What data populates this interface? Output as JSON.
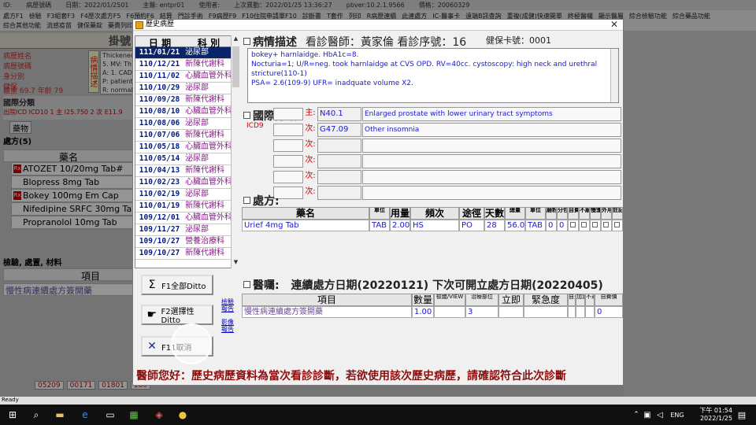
{
  "topbar": {
    "items": [
      "ID:",
      "病歷號碼",
      "日期：2022/01/2501",
      "主醫: entpr01",
      "使用者:",
      "上次異動：2022/01/25 13:36:27",
      "pbver:10.2.1.9566",
      "價格：20060329"
    ]
  },
  "menubar": {
    "row1": [
      "處方F1",
      "檢驗",
      "F3組套F3",
      "F4歷次處方F5",
      "F6預約F6",
      "結算",
      "門診手術",
      "F9病歷F9",
      "F10住院申請單F10",
      "診斷書",
      "T套作",
      "列印",
      "R病歷連續",
      "此連處方",
      "IC-醫事卡",
      "遠端B訊查詢",
      "重複(成健)快速開單",
      "終極醫囑",
      "顯示醫屬",
      "綜合檢驗功能",
      "綜合藥品功能"
    ],
    "row2": [
      "綜合其他功能",
      "流感疫苗",
      "健保藥錠",
      "藥費列印"
    ]
  },
  "background": {
    "title": "掛號",
    "info_labels": [
      "病歷姓名",
      "病歷號碼",
      "身分別",
      "健保"
    ],
    "side_label": "病情描述",
    "desc_lines": [
      "Thickened",
      "5. MV: Th",
      "A: 1. CAD",
      "P: patient",
      "R: normal"
    ],
    "vitals": "體重 69.7   年齡 79",
    "icd_label": "國際分類",
    "icd_row": "出院ICD  ICD10  1 主  I25.750  2 次  E11.9",
    "med_button": "藥物",
    "rx_label": "處方(5)",
    "drug_header": "藥名",
    "drugs": [
      {
        "name": "ATOZET 10/20mg Tab#",
        "rx": true
      },
      {
        "name": "Blopress 8mg Tab",
        "rx": false
      },
      {
        "name": "Bokey 100mg Em Cap",
        "rx": true
      },
      {
        "name": "Nifedipine SRFC 30mg Tab",
        "rx": false
      },
      {
        "name": "Propranolol 10mg Tab",
        "rx": false
      }
    ],
    "exam_label": "檢驗, 處置, 材料",
    "item_header": "項目",
    "item_value": "慢性病連續處方簽開藥",
    "codes": [
      "05209",
      "00171",
      "01801",
      "180"
    ]
  },
  "dialog": {
    "title": "歷史病歷",
    "close": "✕",
    "history_headers": {
      "date": "日 期",
      "dept": "科   別"
    },
    "history": [
      {
        "date": "111/01/21",
        "dept": "泌尿部",
        "selected": true
      },
      {
        "date": "110/12/21",
        "dept": "新陳代謝科"
      },
      {
        "date": "110/11/02",
        "dept": "心臟血管外科"
      },
      {
        "date": "110/10/29",
        "dept": "泌尿部"
      },
      {
        "date": "110/09/28",
        "dept": "新陳代謝科"
      },
      {
        "date": "110/08/10",
        "dept": "心臟血管外科"
      },
      {
        "date": "110/08/06",
        "dept": "泌尿部"
      },
      {
        "date": "110/07/06",
        "dept": "新陳代謝科"
      },
      {
        "date": "110/05/18",
        "dept": "心臟血管外科"
      },
      {
        "date": "110/05/14",
        "dept": "泌尿部"
      },
      {
        "date": "110/04/13",
        "dept": "新陳代謝科"
      },
      {
        "date": "110/02/23",
        "dept": "心臟血管外科"
      },
      {
        "date": "110/02/19",
        "dept": "泌尿部"
      },
      {
        "date": "110/01/19",
        "dept": "新陳代謝科"
      },
      {
        "date": "109/12/01",
        "dept": "心臟血管外科"
      },
      {
        "date": "109/11/27",
        "dept": "泌尿部"
      },
      {
        "date": "109/10/27",
        "dept": "營養治療科"
      },
      {
        "date": "109/10/27",
        "dept": "新陳代謝科"
      }
    ],
    "buttons": {
      "ditto_all": "F1全部Ditto",
      "ditto_select": "F2選擇性Ditto",
      "cancel": "F11取消"
    },
    "side_links": [
      "檢驗報告",
      "影像報告"
    ],
    "desc_section": {
      "label": "病情描述",
      "doctor": "看診醫師：黃家倫  看診序號：16",
      "card": "健保卡號：0001",
      "text": [
        "bokey+ harnlaidge. HbA1c=8.",
        "Nocturia=1;  U/R=neg. took harnlaidge at CVS OPD. RV=40cc. cystoscopy: high neck and  urethral stricture(110-1)",
        "PSA= 2.6(109-9)  UFR= inadquate volume X2."
      ]
    },
    "icd_section": {
      "label": "國際分類:",
      "sublabel": "ICD9",
      "rows": [
        {
          "tag": "主:",
          "code": "N40.1",
          "name": "Enlarged prostate with lower urinary tract symptoms"
        },
        {
          "tag": "次:",
          "code": "G47.09",
          "name": "Other insomnia"
        },
        {
          "tag": "次:",
          "code": "",
          "name": ""
        },
        {
          "tag": "次:",
          "code": "",
          "name": ""
        },
        {
          "tag": "次:",
          "code": "",
          "name": ""
        },
        {
          "tag": "次:",
          "code": "",
          "name": ""
        }
      ]
    },
    "rx_section": {
      "label": "處方:",
      "headers": [
        "藥名",
        "單位",
        "用量",
        "頻次",
        "途徑",
        "天數",
        "總量",
        "單位",
        "磨粉",
        "分包",
        "自費",
        "不磨",
        "慢箋",
        "外用",
        "註記"
      ],
      "rows": [
        {
          "name": "Urief 4mg Tab",
          "unit": "TAB",
          "dose": "2.00",
          "freq": "HS",
          "route": "PO",
          "days": "28",
          "total": "56.0",
          "tunit": "TAB",
          "grind": "0",
          "pack": "0"
        }
      ]
    },
    "advice_section": {
      "label": "醫囑:",
      "text": "連續處方日期(20220121)  下次可開立處方日期(20220405)",
      "headers": [
        "項目",
        "數量",
        "檢體/VIEW",
        "治療部位",
        "立即",
        "緊急度",
        "自費",
        "加急",
        "不適回費",
        "自費價"
      ],
      "rows": [
        {
          "item": "慢性病連續處方簽開藥",
          "qty": "1.00",
          "view": "",
          "site": "3",
          "now": "",
          "urgency": "",
          "self": "",
          "add": "",
          "return": "",
          "price": "0"
        }
      ]
    },
    "notice": "醫師您好：歷史病歷資料為當次看診診斷，若欲使用該次歷史病歷，請確認符合此次診斷"
  },
  "status": "Ready",
  "taskbar": {
    "time": "下午 01:54",
    "date": "2022/1/25",
    "lang": "ENG"
  },
  "colors": {
    "selected_row": "#0a246a",
    "date_text": "#001a80",
    "dept_text": "#8a1a8a",
    "notice_text": "#8a1010",
    "desc_text": "#1a1acc"
  }
}
